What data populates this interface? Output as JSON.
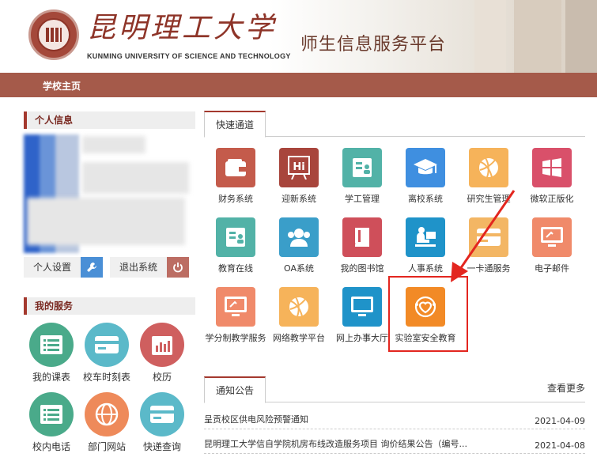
{
  "header": {
    "university_cn": "昆明理工大学",
    "university_en": "KUNMING UNIVERSITY OF SCIENCE AND TECHNOLOGY",
    "platform_title": "师生信息服务平台",
    "brand_color": "#a55a4a"
  },
  "nav": {
    "home": "学校主页"
  },
  "profile": {
    "section_title": "个人信息",
    "settings_label": "个人设置",
    "logout_label": "退出系统",
    "settings_icon": "wrench-icon",
    "logout_icon": "power-icon"
  },
  "services": {
    "section_title": "我的服务",
    "items": [
      {
        "label": "我的课表",
        "icon": "list-icon",
        "color": "#4aaa8a"
      },
      {
        "label": "校车时刻表",
        "icon": "card-icon",
        "color": "#5bb9c9"
      },
      {
        "label": "校历",
        "icon": "calendar-chart-icon",
        "color": "#cf5f5f"
      },
      {
        "label": "校内电话",
        "icon": "list-icon",
        "color": "#4aaa8a"
      },
      {
        "label": "部门网站",
        "icon": "globe-icon",
        "color": "#ee8a5a"
      },
      {
        "label": "快递查询",
        "icon": "card-icon",
        "color": "#5bb9c9"
      }
    ]
  },
  "quick": {
    "tab_label": "快速通道",
    "apps": [
      {
        "label": "财务系统",
        "icon": "wallet-icon",
        "color": "#c45b4b"
      },
      {
        "label": "迎新系统",
        "icon": "hi-board-icon",
        "color": "#a8453c"
      },
      {
        "label": "学工管理",
        "icon": "id-card-icon",
        "color": "#52b2a7"
      },
      {
        "label": "离校系统",
        "icon": "graduation-cap-icon",
        "color": "#3f8fe0"
      },
      {
        "label": "研究生管理",
        "icon": "basketball-icon",
        "color": "#f6b35a"
      },
      {
        "label": "微软正版化",
        "icon": "windows-icon",
        "color": "#d9506a"
      },
      {
        "label": "教育在线",
        "icon": "id-card-icon",
        "color": "#52b2a7"
      },
      {
        "label": "OA系统",
        "icon": "users-icon",
        "color": "#3a9ec9"
      },
      {
        "label": "我的图书馆",
        "icon": "book-icon",
        "color": "#cf4f5a"
      },
      {
        "label": "人事系统",
        "icon": "desk-person-icon",
        "color": "#1f93c9"
      },
      {
        "label": "一卡通服务",
        "icon": "card-icon",
        "color": "#f3b664"
      },
      {
        "label": "电子邮件",
        "icon": "monitor-icon",
        "color": "#f08a6a"
      },
      {
        "label": "学分制教学服务",
        "icon": "monitor-icon",
        "color": "#f08a6a"
      },
      {
        "label": "网络教学平台",
        "icon": "basketball-icon",
        "color": "#f6b35a"
      },
      {
        "label": "网上办事大厅",
        "icon": "monitor-icon",
        "color": "#1f93c9"
      },
      {
        "label": "实验室安全教育",
        "icon": "shield-heart-icon",
        "color": "#f28a26"
      }
    ]
  },
  "notices": {
    "tab_label": "通知公告",
    "more_label": "查看更多",
    "items": [
      {
        "title": "呈贡校区供电风险预警通知",
        "date": "2021-04-09"
      },
      {
        "title": "昆明理工大学信自学院机房布线改造服务项目 询价结果公告（编号...",
        "date": "2021-04-08"
      }
    ]
  },
  "annotation": {
    "highlight_color": "#e3261f"
  }
}
